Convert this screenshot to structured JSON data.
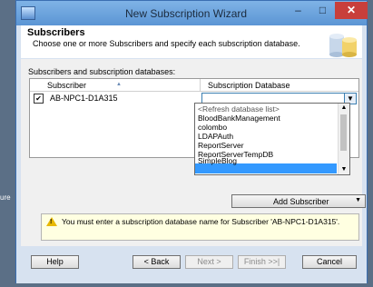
{
  "background": {
    "text": "ure"
  },
  "window": {
    "title": "New Subscription Wizard",
    "controls": {
      "minimize": "–",
      "maximize": "□",
      "close": "✕"
    }
  },
  "header": {
    "title": "Subscribers",
    "subtitle": "Choose one or more Subscribers and specify each subscription database."
  },
  "section_label": "Subscribers and subscription databases:",
  "grid": {
    "columns": [
      "Subscriber",
      "Subscription Database"
    ],
    "rows": [
      {
        "checked": true,
        "checkbox_glyph": "✔",
        "subscriber": "AB-NPC1-D1A315",
        "database": ""
      }
    ]
  },
  "dropdown": {
    "arrow": "▼",
    "options": [
      "<Refresh database list>",
      "BloodBankManagement",
      "colombo",
      "LDAPAuth",
      "ReportServer",
      "ReportServerTempDB",
      "SimpleBlog",
      ""
    ],
    "highlighted_index": 7,
    "scroll_up": "▲",
    "scroll_down": "▼"
  },
  "add_subscriber": {
    "label": "Add Subscriber",
    "arrow": "▼"
  },
  "message": {
    "icon": "warning-icon",
    "icon_glyph": "!",
    "text": "You must enter a subscription database name for Subscriber 'AB-NPC1-D1A315'."
  },
  "buttons": {
    "help": "Help",
    "back": "< Back",
    "next": "Next >",
    "finish": "Finish >>|",
    "cancel": "Cancel"
  },
  "colors": {
    "title_bar": "#6aa3dc",
    "close": "#c83f3b",
    "highlight": "#3399ff",
    "message_bg": "#ffffe1"
  }
}
